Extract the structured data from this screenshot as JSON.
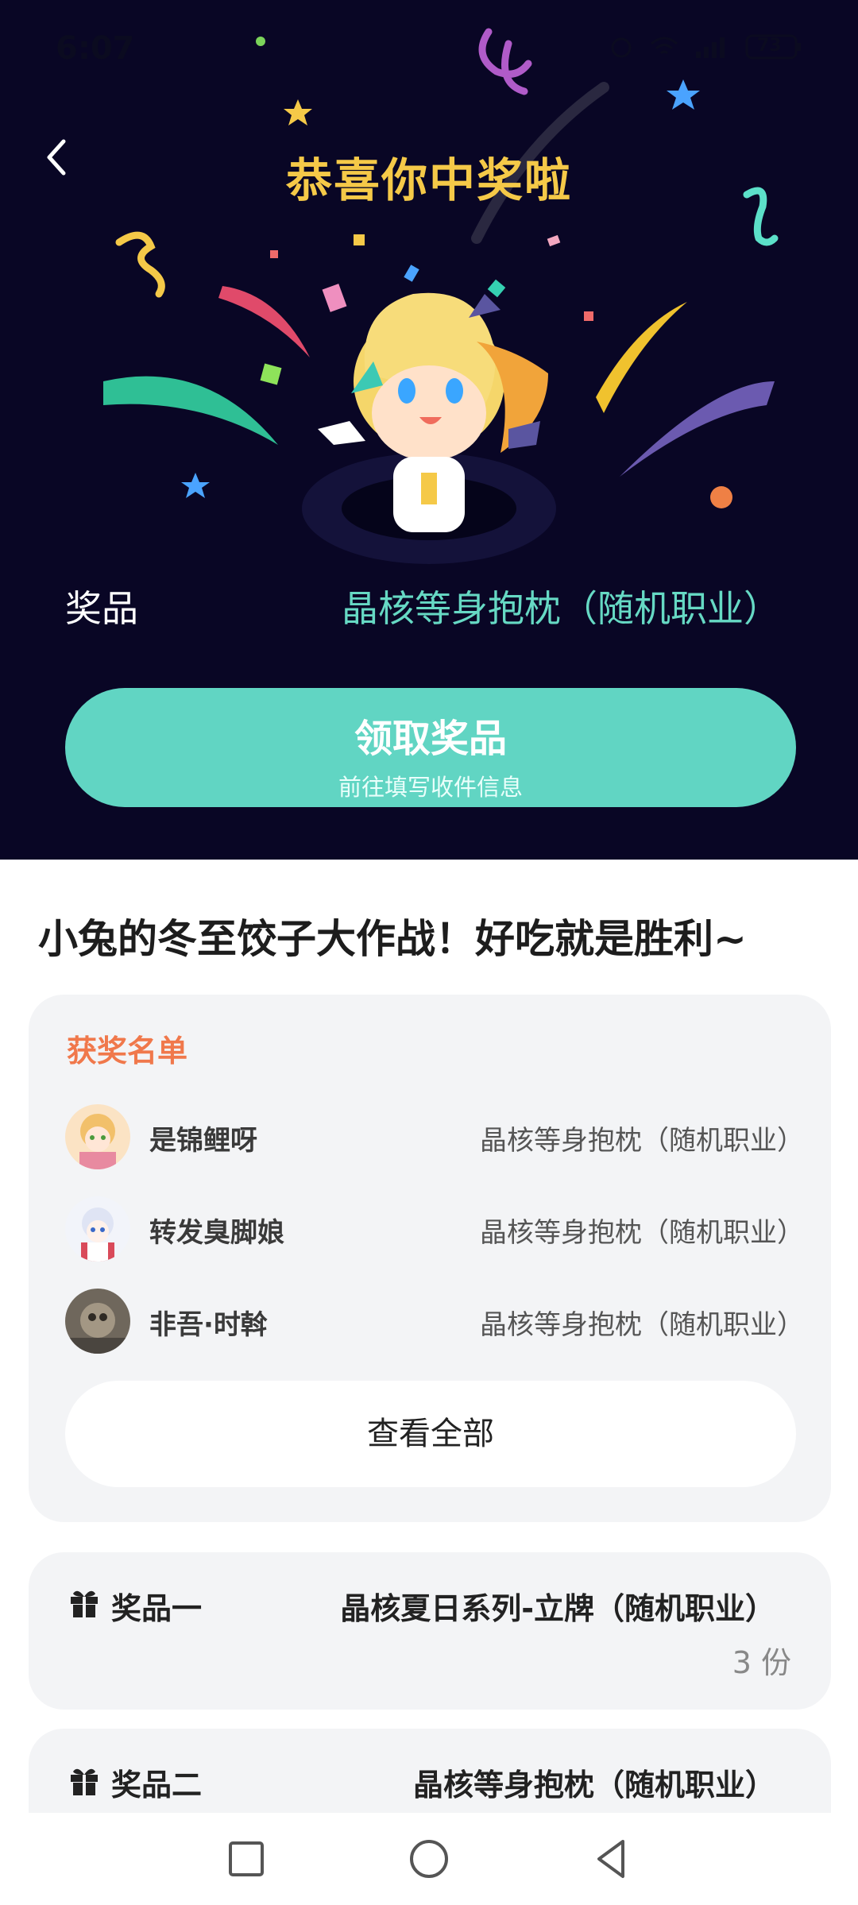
{
  "status_bar": {
    "time": "6:07",
    "battery": "73"
  },
  "hero": {
    "title": "恭喜你中奖啦",
    "prize_label": "奖品",
    "prize_value": "晶核等身抱枕（随机职业）",
    "claim_button": "领取奖品",
    "claim_subtitle": "前往填写收件信息"
  },
  "event": {
    "title": "小兔的冬至饺子大作战！好吃就是胜利~"
  },
  "winners": {
    "title": "获奖名单",
    "items": [
      {
        "name": "是锦鲤呀",
        "prize": "晶核等身抱枕（随机职业）"
      },
      {
        "name": "转发臭脚娘",
        "prize": "晶核等身抱枕（随机职业）"
      },
      {
        "name": "非吾·时斡",
        "prize": "晶核等身抱枕（随机职业）"
      }
    ],
    "view_all": "查看全部"
  },
  "prizes": [
    {
      "label": "奖品一",
      "value": "晶核夏日系列-立牌（随机职业）",
      "count": "3 份"
    },
    {
      "label": "奖品二",
      "value": "晶核等身抱枕（随机职业）"
    }
  ],
  "colors": {
    "hero_bg": "#090625",
    "accent_teal": "#61d5c3",
    "title_gold": "#f5c948",
    "winners_title": "#f0784b"
  }
}
